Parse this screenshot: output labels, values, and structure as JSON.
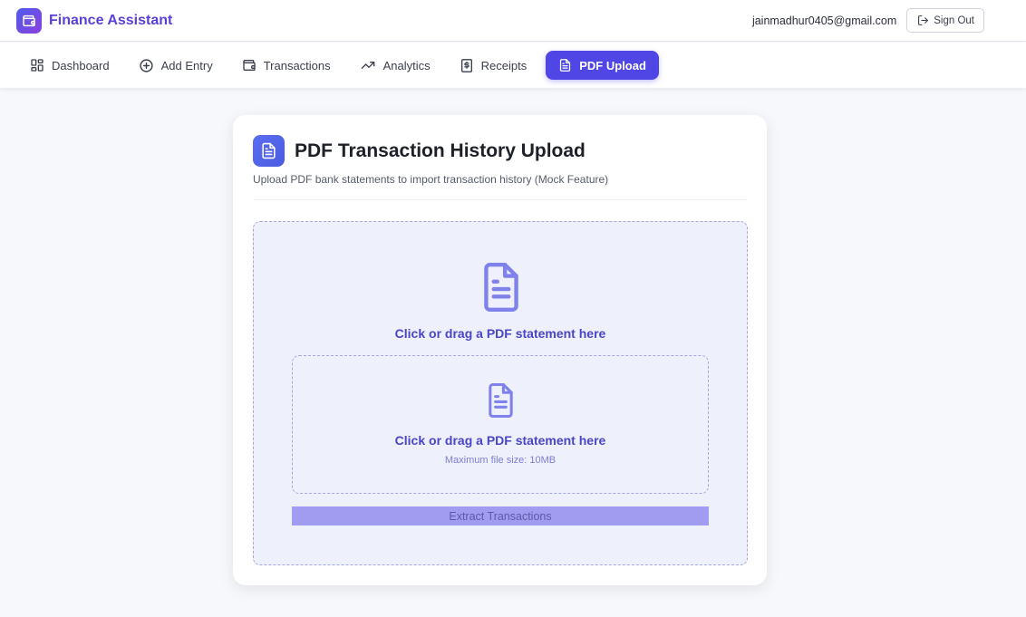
{
  "app": {
    "name": "Finance Assistant",
    "logo_icon": "wallet-icon",
    "brand_color": "#5b3fd9"
  },
  "header": {
    "user_email": "jainmadhur0405@gmail.com",
    "signout_label": "Sign Out"
  },
  "nav": {
    "items": [
      {
        "label": "Dashboard",
        "icon": "dashboard-grid-icon"
      },
      {
        "label": "Add Entry",
        "icon": "plus-circle-icon"
      },
      {
        "label": "Transactions",
        "icon": "wallet-icon"
      },
      {
        "label": "Analytics",
        "icon": "trending-up-icon"
      },
      {
        "label": "Receipts",
        "icon": "receipt-dollar-icon"
      },
      {
        "label": "PDF Upload",
        "icon": "document-icon",
        "active": true
      }
    ],
    "active_color": "#4f46e5"
  },
  "card": {
    "title": "PDF Transaction History Upload",
    "subtitle": "Upload PDF bank statements to import transaction history (Mock Feature)",
    "dropzone": {
      "outer_text": "Click or drag a PDF statement here",
      "inner_text": "Click or drag a PDF statement here",
      "hint": "Maximum file size: 10MB"
    },
    "extract_label": "Extract Transactions"
  }
}
